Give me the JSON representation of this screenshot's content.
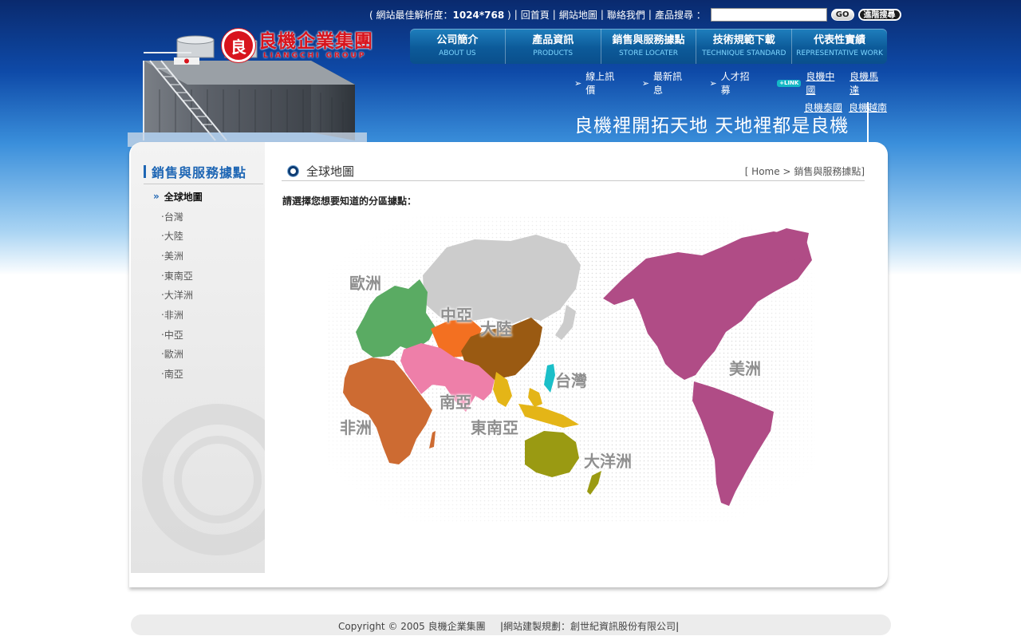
{
  "topbar": {
    "resolution_prefix": "( 網站最佳解析度：",
    "resolution_value": "1024*768",
    "resolution_suffix": " )",
    "links": [
      "回首頁",
      "網站地圖",
      "聯絡我們"
    ],
    "search_label": "產品搜尋 ：",
    "search_value": "",
    "go_label": "GO",
    "advanced_label": "進階搜尋"
  },
  "logo": {
    "mark": "良",
    "cn": "良機企業集團",
    "en": "LIANGCHI GROUP"
  },
  "mainnav": [
    {
      "zh": "公司簡介",
      "en": "ABOUT US"
    },
    {
      "zh": "產品資訊",
      "en": "PRODUCTS"
    },
    {
      "zh": "銷售與服務據點",
      "en": "STORE LOCATER"
    },
    {
      "zh": "技術規範下載",
      "en": "TECHNIQUE STANDARD"
    },
    {
      "zh": "代表性實績",
      "en": "REPRESENTATIVE WORK"
    }
  ],
  "subnav": {
    "items": [
      "線上訊價",
      "最新訊息",
      "人才招募"
    ],
    "link_tag": "+LINK",
    "external": [
      "良機中國",
      "良機馬達",
      "良機泰國",
      "良機越南"
    ]
  },
  "slogan": "良機裡開拓天地  天地裡都是良機",
  "sidebar": {
    "title": "銷售與服務據點",
    "items": [
      "全球地圖",
      "‧台灣",
      "‧大陸",
      "‧美洲",
      "‧東南亞",
      "‧大洋洲",
      "‧非洲",
      "‧中亞",
      "‧歐洲",
      "‧南亞"
    ]
  },
  "content": {
    "title": "全球地圖",
    "breadcrumb_home": "[ Home > ",
    "breadcrumb_current": "銷售與服務據點]",
    "prompt": "請選擇您想要知道的分區據點："
  },
  "map": {
    "labels": {
      "europe": "歐洲",
      "central_asia": "中亞",
      "mainland": "大陸",
      "taiwan": "台灣",
      "south_asia": "南亞",
      "africa": "非洲",
      "southeast_asia": "東南亞",
      "oceania": "大洋洲",
      "americas": "美洲"
    },
    "colors": {
      "europe": "#5aab63",
      "russia": "#cccccc",
      "central_asia": "#f37021",
      "mainland": "#9a5a12",
      "south_asia": "#ee7fa9",
      "africa": "#cd6b32",
      "southeast_asia": "#e4b517",
      "taiwan": "#1bbfc8",
      "oceania": "#9a9a12",
      "americas": "#b04c86"
    }
  },
  "footer": {
    "copyright": "Copyright © 2005    良機企業集團",
    "builder": "網站建製規劃：創世紀資訊股份有限公司"
  }
}
